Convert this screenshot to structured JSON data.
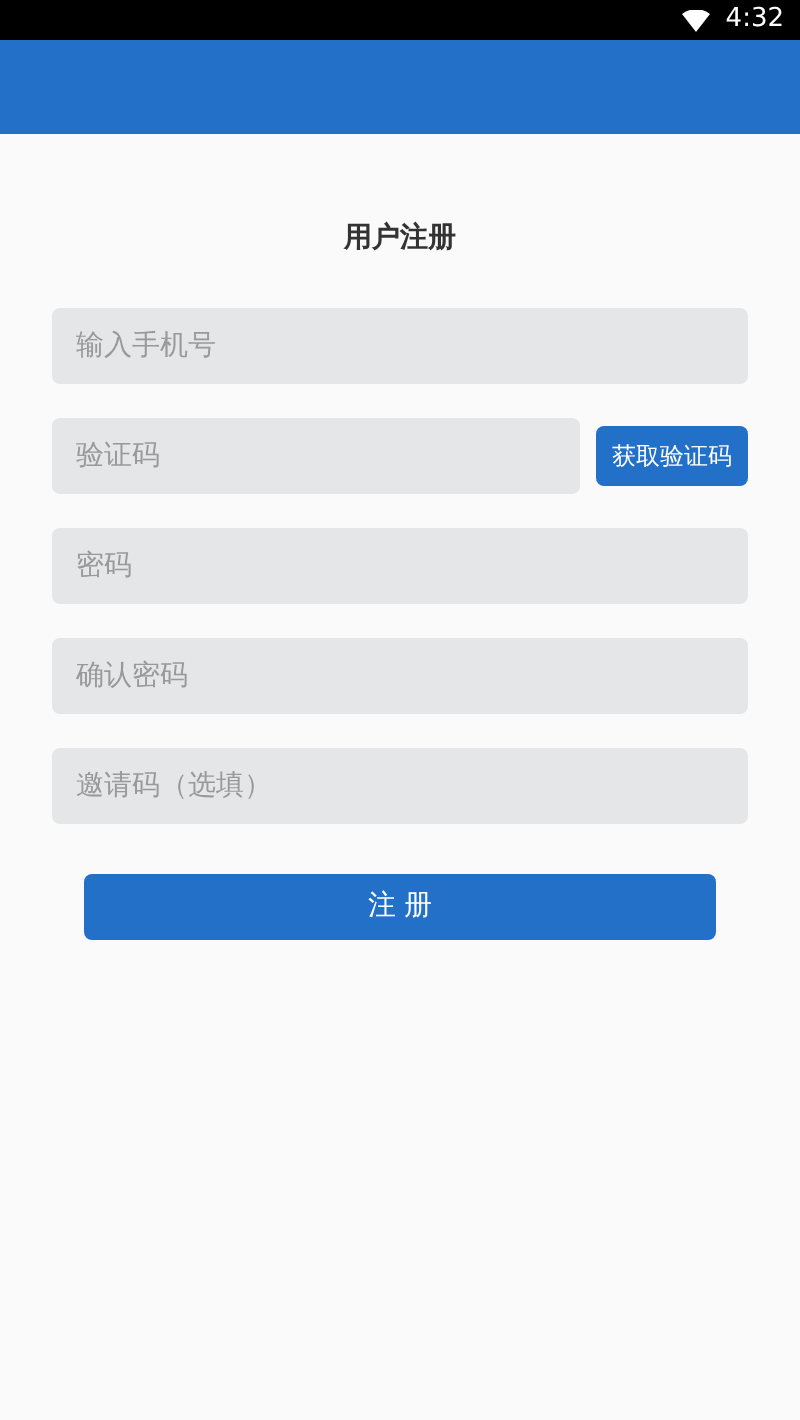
{
  "status_bar": {
    "time": "4:32"
  },
  "title": "用户注册",
  "fields": [
    {
      "placeholder": "输入手机号"
    },
    {
      "placeholder": "验证码",
      "button": "获取验证码"
    },
    {
      "placeholder": "密码"
    },
    {
      "placeholder": "确认密码"
    },
    {
      "placeholder": "邀请码（选填）"
    }
  ],
  "submit": "注 册"
}
